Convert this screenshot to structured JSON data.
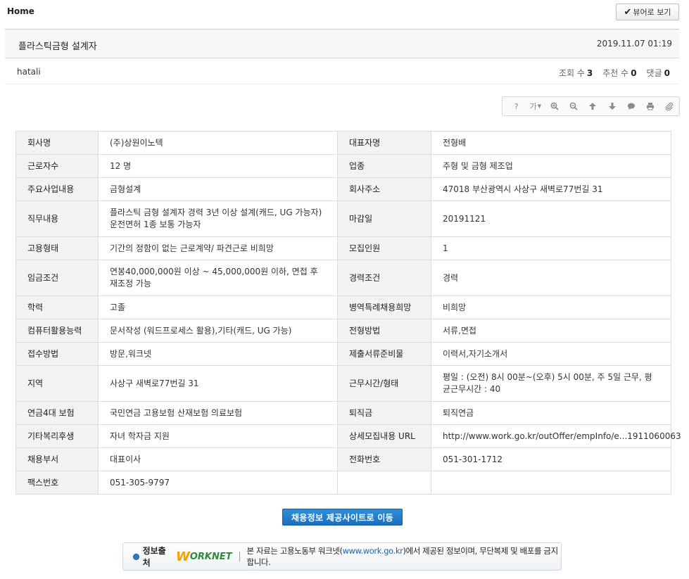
{
  "header": {
    "home_label": "Home",
    "viewer_button_label": "뷰어로 보기"
  },
  "post": {
    "title": "플라스틱금형 설계자",
    "date": "2019.11.07 01:19",
    "author": "hatali",
    "views_label": "조회 수",
    "views": "3",
    "likes_label": "추천 수",
    "likes": "0",
    "comments_label": "댓글",
    "comments": "0"
  },
  "toolbar": {
    "items": [
      "help-icon",
      "font-size-icon",
      "zoom-in-icon",
      "zoom-out-icon",
      "arrow-up-icon",
      "arrow-down-icon",
      "comment-icon",
      "print-icon",
      "attachment-icon"
    ],
    "help_glyph": "?",
    "font_glyph": "가"
  },
  "table": {
    "rows": [
      {
        "k1": "회사명",
        "v1": "(주)상원이노텍",
        "k2": "대표자명",
        "v2": "전형배"
      },
      {
        "k1": "근로자수",
        "v1": "12 명",
        "k2": "업종",
        "v2": "주형 및 금형 제조업"
      },
      {
        "k1": "주요사업내용",
        "v1": "금형설계",
        "k2": "회사주소",
        "v2": "47018 부산광역시 사상구 새벽로77번길 31"
      },
      {
        "k1": "직무내용",
        "v1": "플라스틱 금형 설계자 경력 3년 이상 설계(캐드, UG 가능자) 운전면허 1종 보통 가능자",
        "k2": "마감일",
        "v2": "20191121"
      },
      {
        "k1": "고용형태",
        "v1": "기간의 정함이 없는 근로계약/ 파견근로 비희망",
        "k2": "모집인원",
        "v2": "1"
      },
      {
        "k1": "임금조건",
        "v1": "연봉40,000,000원 이상 ~ 45,000,000원 이하, 면접 후 재조정 가능",
        "k2": "경력조건",
        "v2": "경력"
      },
      {
        "k1": "학력",
        "v1": "고졸",
        "k2": "병역특례채용희망",
        "v2": "비희망"
      },
      {
        "k1": "컴퓨터활용능력",
        "v1": "문서작성 (워드프로세스 활용),기타(캐드, UG 가능)",
        "k2": "전형방법",
        "v2": "서류,면접"
      },
      {
        "k1": "접수방법",
        "v1": "방문,워크넷",
        "k2": "제출서류준비물",
        "v2": "이력서,자기소개서"
      },
      {
        "k1": "지역",
        "v1": "사상구 새벽로77번길 31",
        "k2": "근무시간/형태",
        "v2": "평일 : (오전) 8시 00분~(오후) 5시 00분, 주 5일 근무, 평균근무시간 : 40"
      },
      {
        "k1": "연금4대 보험",
        "v1": "국민연금 고용보험 산재보험 의료보험",
        "k2": "퇴직금",
        "v2": "퇴직연금"
      },
      {
        "k1": "기타복리후생",
        "v1": "자녀 학자금 지원",
        "k2": "상세모집내용 URL",
        "v2": "http://www.work.go.kr/outOffer/empInfo/e...1911060063"
      },
      {
        "k1": "채용부서",
        "v1": "대표이사",
        "k2": "전화번호",
        "v2": "051-301-1712"
      },
      {
        "k1": "팩스번호",
        "v1": "051-305-9797",
        "k2": "",
        "v2": ""
      }
    ]
  },
  "footer": {
    "go_button_label": "채용정보 제공사이트로 이동",
    "source_label": "정보출처",
    "logo_w": "W",
    "logo_rest": "ORKNET",
    "notice_prefix": "본 자료는 고용노동부 워크넷(",
    "notice_url": "www.work.go.kr",
    "notice_suffix": ")에서 제공된 정보이며, 무단복제 및 배포를 금지합니다."
  }
}
